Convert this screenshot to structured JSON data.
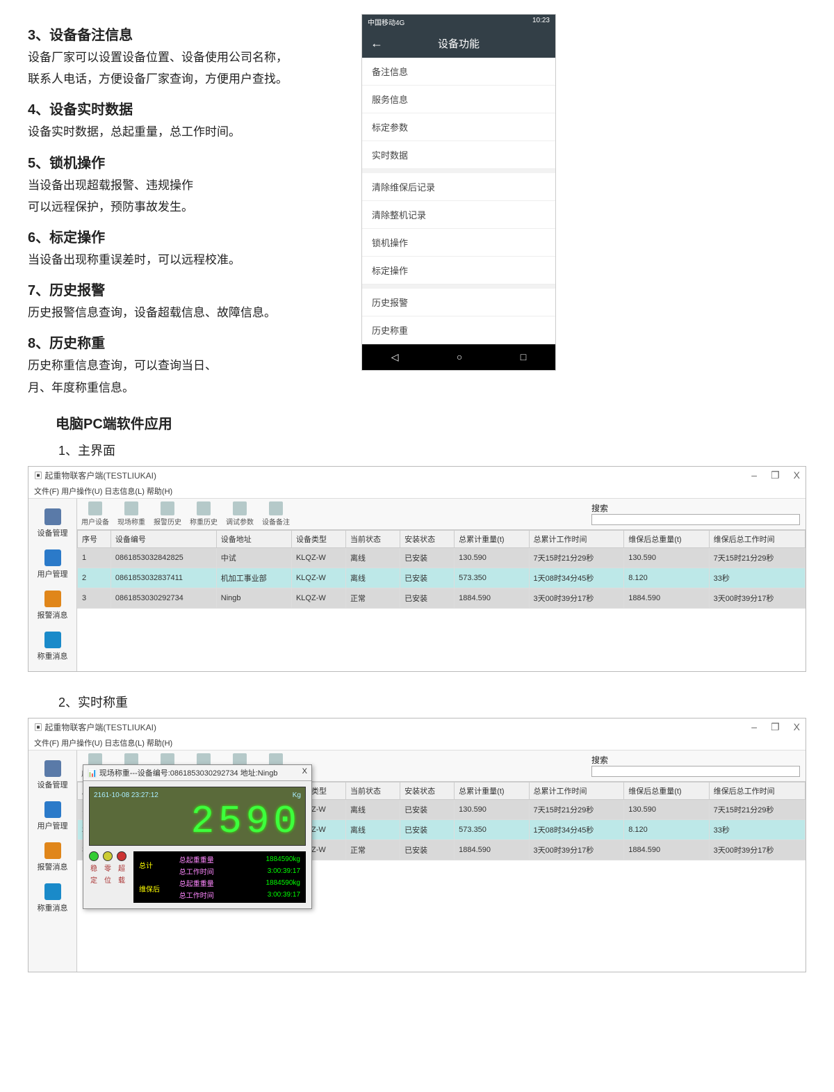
{
  "sections": [
    {
      "h": "3、设备备注信息",
      "p": [
        "设备厂家可以设置设备位置、设备使用公司名称，",
        "联系人电话，方便设备厂家查询，方便用户查找。"
      ]
    },
    {
      "h": "4、设备实时数据",
      "p": [
        "设备实时数据，总起重量，总工作时间。"
      ]
    },
    {
      "h": "5、锁机操作",
      "p": [
        "当设备出现超载报警、违规操作",
        "可以远程保护，预防事故发生。"
      ]
    },
    {
      "h": "6、标定操作",
      "p": [
        "当设备出现称重误差时，可以远程校准。"
      ]
    },
    {
      "h": "7、历史报警",
      "p": [
        "历史报警信息查询，设备超载信息、故障信息。"
      ]
    },
    {
      "h": "8、历史称重",
      "p": [
        "历史称重信息查询，可以查询当日、",
        "月、年度称重信息。"
      ]
    }
  ],
  "phone": {
    "carrier": "中国移动4G",
    "time": "10:23",
    "title": "设备功能",
    "back": "←",
    "groups": [
      [
        "备注信息",
        "服务信息",
        "标定参数",
        "实时数据"
      ],
      [
        "清除维保后记录",
        "清除整机记录",
        "锁机操作",
        "标定操作"
      ],
      [
        "历史报警",
        "历史称重"
      ]
    ],
    "nav": [
      "◁",
      "○",
      "□"
    ]
  },
  "pcTitle": "电脑PC端软件应用",
  "sub1": "1、主界面",
  "sub2": "2、实时称重",
  "pc": {
    "title": "起重物联客户端(TESTLIUKAI)",
    "winBtns": [
      "–",
      "❐",
      "X"
    ],
    "menu": "文件(F)  用户操作(U)  日志信息(L)  帮助(H)",
    "sidebar": [
      {
        "name": "dev-mgmt",
        "lbl": "设备管理",
        "fill": "#5a7aa8"
      },
      {
        "name": "user-mgmt",
        "lbl": "用户管理",
        "fill": "#2b7ac9"
      },
      {
        "name": "alarm-msg",
        "lbl": "报警消息",
        "fill": "#e0861a"
      },
      {
        "name": "weigh-msg",
        "lbl": "称重消息",
        "fill": "#1a8ac9"
      }
    ],
    "toolbar": [
      {
        "name": "user-dev",
        "lbl": "用户设备"
      },
      {
        "name": "live-weigh",
        "lbl": "现场称重"
      },
      {
        "name": "alarm-hist",
        "lbl": "报警历史"
      },
      {
        "name": "weigh-hist",
        "lbl": "称重历史"
      },
      {
        "name": "debug-param",
        "lbl": "调试参数"
      },
      {
        "name": "dev-remark",
        "lbl": "设备备注"
      }
    ],
    "searchLbl": "搜索",
    "cols": [
      "序号",
      "设备编号",
      "设备地址",
      "设备类型",
      "当前状态",
      "安装状态",
      "总累计重量(t)",
      "总累计工作时间",
      "维保后总重量(t)",
      "维保后总工作时间"
    ],
    "rows": [
      {
        "cls": "row-g",
        "c": [
          "1",
          "0861853032842825",
          "中试",
          "KLQZ-W",
          "离线",
          "已安装",
          "130.590",
          "7天15时21分29秒",
          "130.590",
          "7天15时21分29秒"
        ],
        "st": "c-off"
      },
      {
        "cls": "row-b",
        "c": [
          "2",
          "0861853032837411",
          "机加工事业部",
          "KLQZ-W",
          "离线",
          "已安装",
          "573.350",
          "1天08时34分45秒",
          "8.120",
          "33秒"
        ],
        "st": "c-off"
      },
      {
        "cls": "row-g",
        "c": [
          "3",
          "0861853030292734",
          "Ningb",
          "KLQZ-W",
          "正常",
          "已安装",
          "1884.590",
          "3天00时39分17秒",
          "1884.590",
          "3天00时39分17秒"
        ],
        "st": "c-on"
      }
    ]
  },
  "rt": {
    "popTitle": "现场称重---设备编号:0861853030292734 地址:Ningb",
    "close": "X",
    "ts": "2161-10-08 23:27:12",
    "unit": "Kg",
    "digits": "2590",
    "ledCols": [
      [
        "稳",
        "定"
      ],
      [
        "零",
        "位"
      ],
      [
        "超",
        "载"
      ]
    ],
    "stat": {
      "h1": "总计",
      "h2": "维保后",
      "r": [
        [
          "总起重重量",
          "1884590kg"
        ],
        [
          "总工作时间",
          "3:00:39:17"
        ],
        [
          "总起重重量",
          "1884590kg"
        ],
        [
          "总工作时间",
          "3:00:39:17"
        ]
      ]
    }
  },
  "chart_data": {
    "type": "table",
    "title": "设备列表",
    "columns": [
      "序号",
      "设备编号",
      "设备地址",
      "设备类型",
      "当前状态",
      "安装状态",
      "总累计重量(t)",
      "总累计工作时间",
      "维保后总重量(t)",
      "维保后总工作时间"
    ],
    "rows": [
      [
        1,
        "0861853032842825",
        "中试",
        "KLQZ-W",
        "离线",
        "已安装",
        130.59,
        "7天15时21分29秒",
        130.59,
        "7天15时21分29秒"
      ],
      [
        2,
        "0861853032837411",
        "机加工事业部",
        "KLQZ-W",
        "离线",
        "已安装",
        573.35,
        "1天08时34分45秒",
        8.12,
        "33秒"
      ],
      [
        3,
        "0861853030292734",
        "Ningb",
        "KLQZ-W",
        "正常",
        "已安装",
        1884.59,
        "3天00时39分17秒",
        1884.59,
        "3天00时39分17秒"
      ]
    ]
  }
}
